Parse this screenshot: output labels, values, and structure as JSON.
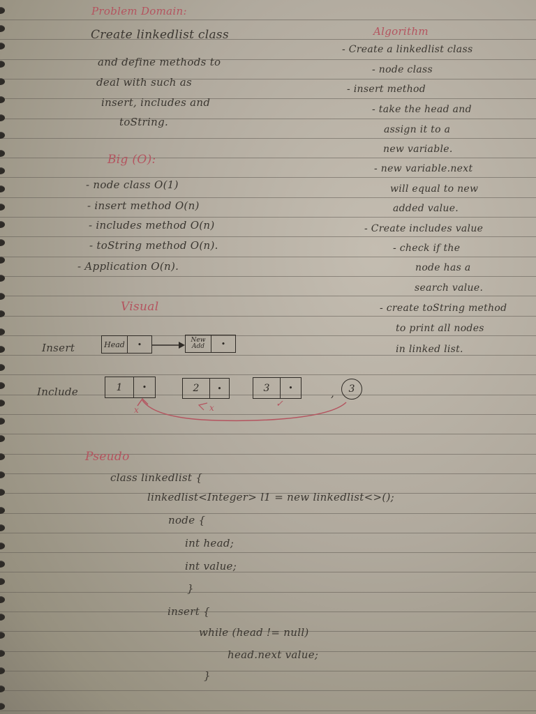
{
  "problem_domain": {
    "heading": "Problem Domain:",
    "lines": [
      "Create linkedlist class",
      "and define methods to",
      "deal with such as",
      "insert, includes and",
      "toString."
    ]
  },
  "big_o": {
    "heading": "Big (O):",
    "lines": [
      "- node class O(1)",
      "- insert method O(n)",
      "- includes method O(n)",
      "- toString method O(n).",
      "- Application O(n)."
    ]
  },
  "algorithm": {
    "heading": "Algorithm",
    "lines": [
      "- Create a linkedlist class",
      "- node class",
      "- insert method",
      "- take the head and",
      "assign it to a",
      "new variable.",
      "- new variable.next",
      "will equal to new",
      "added value.",
      "- Create includes value",
      "- check if the",
      "node has a",
      "search value.",
      "- create toString method",
      "to print all nodes",
      "in linked list."
    ]
  },
  "visual": {
    "heading": "Visual",
    "insert_label": "Insert",
    "include_label": "Include",
    "insert_nodes": [
      {
        "value": "Head",
        "next": "•"
      },
      {
        "value": "New Add",
        "next": "•"
      }
    ],
    "include_nodes": [
      {
        "value": "1",
        "next": "•",
        "mark": "x"
      },
      {
        "value": "2",
        "next": "•",
        "mark": "x"
      },
      {
        "value": "3",
        "next": "•",
        "mark": "✓"
      }
    ],
    "search_value": "3"
  },
  "pseudo": {
    "heading": "Pseudo",
    "lines": [
      "class linkedlist {",
      "linkedlist<Integer> l1 = new linkedlist<>();",
      "node {",
      "int head;",
      "int value;",
      "}",
      "insert {",
      "while (head != null)",
      "head.next value;",
      "}"
    ]
  },
  "colors": {
    "ink": "#3a3630",
    "red_ink": "#b4545f",
    "paper": "#b0a99d"
  }
}
